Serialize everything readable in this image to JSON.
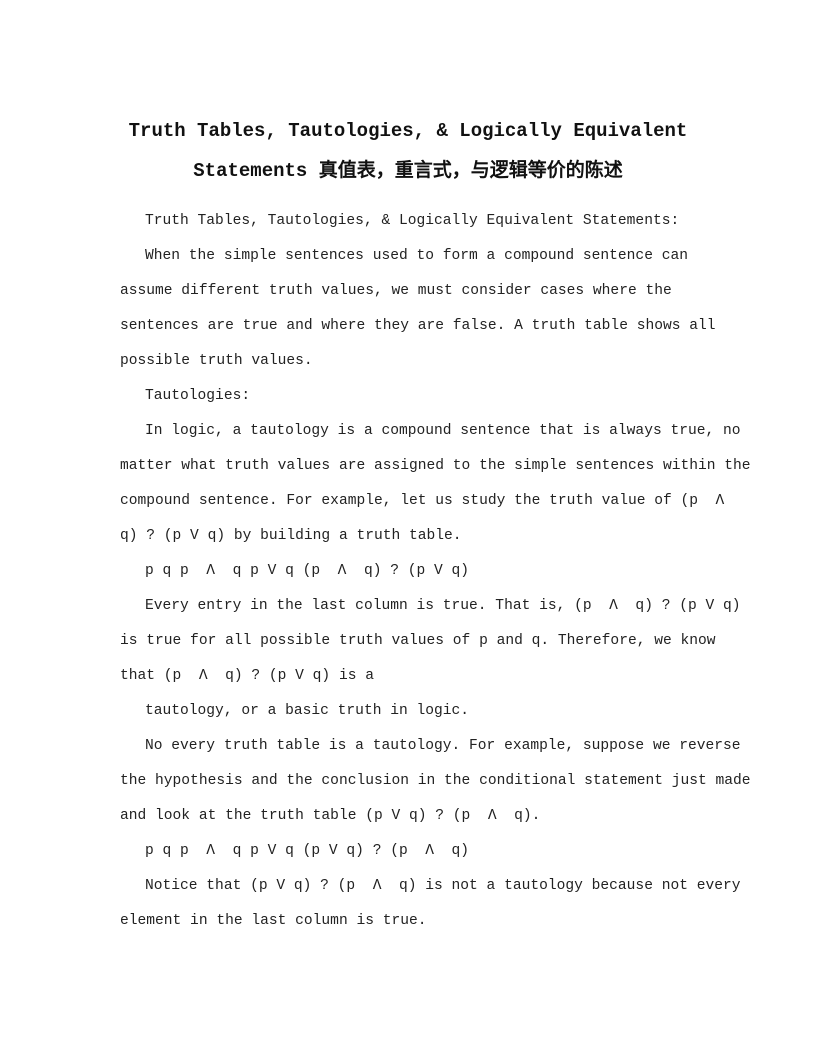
{
  "document": {
    "title_line1": "Truth Tables, Tautologies, & Logically Equivalent",
    "title_line2": "Statements 真值表，重言式，与逻辑等价的陈述",
    "lines": [
      "Truth Tables, Tautologies, & Logically Equivalent Statements:",
      "When the simple sentences used to form a compound sentence can",
      "assume different truth values, we must consider cases where the",
      "sentences are true and where they are false. A truth table shows all",
      "possible truth values.",
      "Tautologies:",
      "In logic, a tautology is a compound sentence that is always true, no",
      "matter what truth values are assigned to the simple sentences within the",
      "compound sentence. For example, let us study the truth value of (p  Λ",
      "q) ? (p V q) by building a truth table.",
      "p q p  Λ  q p V q (p  Λ  q) ? (p V q)",
      "Every entry in the last column is true. That is, (p  Λ  q) ? (p V q)",
      "is true for all possible truth values of p and q. Therefore, we know",
      "that (p  Λ  q) ? (p V q) is a",
      "tautology, or a basic truth in logic.",
      "No every truth table is a tautology. For example, suppose we reverse",
      "the hypothesis and the conclusion in the conditional statement just made",
      "and look at the truth table (p V q) ? (p  Λ  q).",
      "p q p  Λ  q p V q (p V q) ? (p  Λ  q)",
      "Notice that (p V q) ? (p  Λ  q) is not a tautology because not every",
      "element in the last column is true."
    ]
  }
}
